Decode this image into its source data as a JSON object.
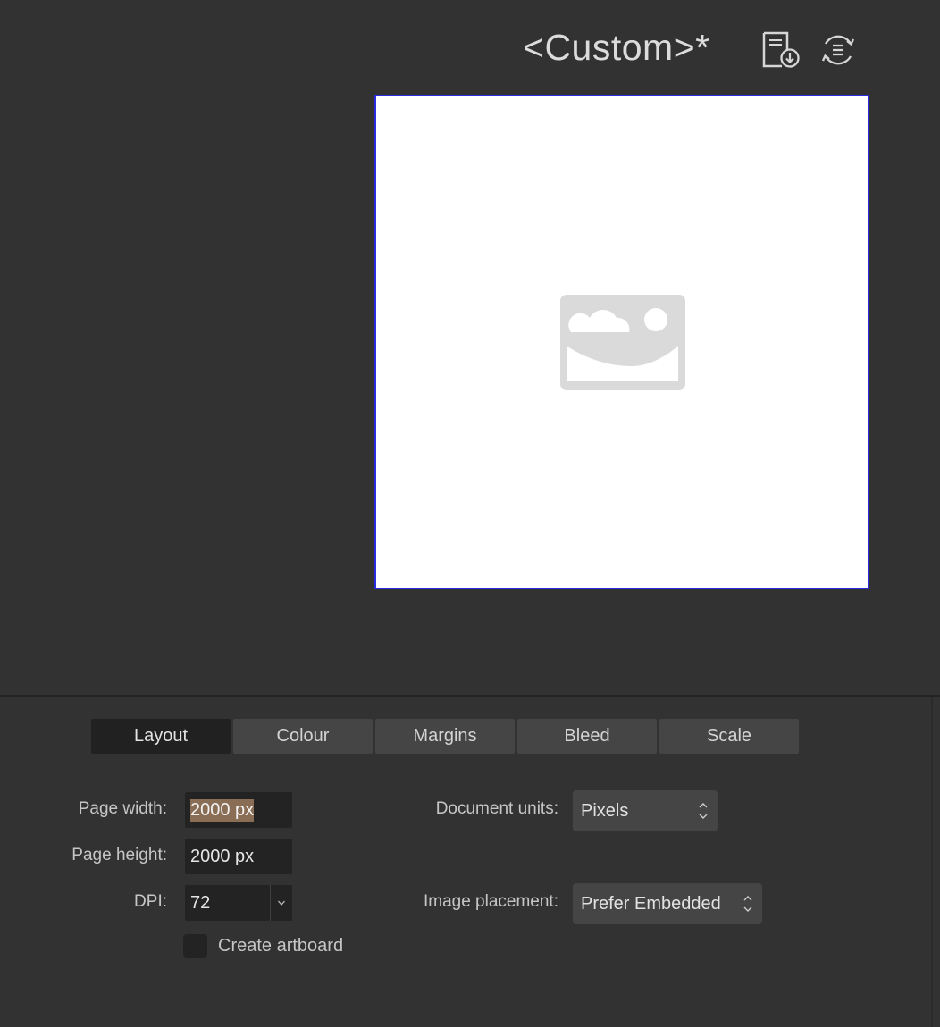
{
  "header": {
    "preset_name": "<Custom>*",
    "icons": [
      "save-preset-icon",
      "manage-presets-icon"
    ]
  },
  "tabs": [
    {
      "label": "Layout",
      "active": true
    },
    {
      "label": "Colour",
      "active": false
    },
    {
      "label": "Margins",
      "active": false
    },
    {
      "label": "Bleed",
      "active": false
    },
    {
      "label": "Scale",
      "active": false
    }
  ],
  "layout": {
    "page_width_label": "Page width:",
    "page_width_value": "2000 px",
    "page_height_label": "Page height:",
    "page_height_value": "2000 px",
    "dpi_label": "DPI:",
    "dpi_value": "72",
    "document_units_label": "Document units:",
    "document_units_value": "Pixels",
    "image_placement_label": "Image placement:",
    "image_placement_value": "Prefer Embedded",
    "create_artboard_label": "Create artboard",
    "create_artboard_checked": false
  },
  "colors": {
    "background": "#323232",
    "preview_border": "#2a2adf",
    "selection_highlight": "#8a6d55"
  }
}
